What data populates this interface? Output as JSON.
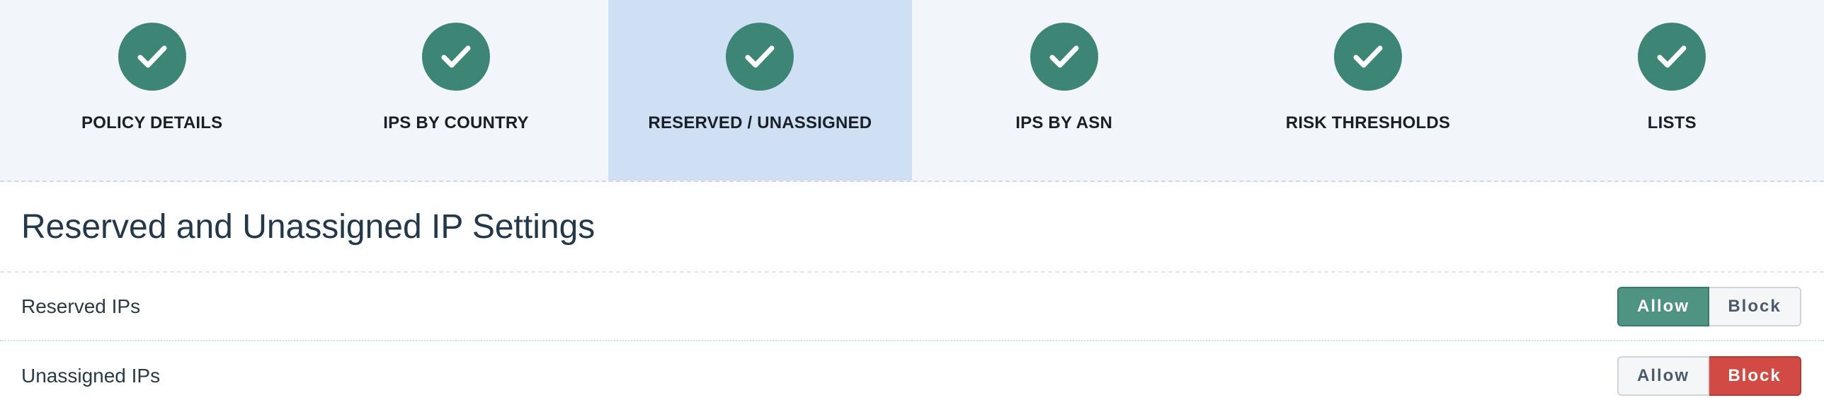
{
  "stepper": {
    "active_index": 2,
    "steps": [
      {
        "label": "POLICY DETAILS",
        "status": "complete",
        "icon": "check-icon"
      },
      {
        "label": "IPS BY COUNTRY",
        "status": "complete",
        "icon": "check-icon"
      },
      {
        "label": "RESERVED / UNASSIGNED",
        "status": "complete",
        "icon": "check-icon"
      },
      {
        "label": "IPS BY ASN",
        "status": "complete",
        "icon": "check-icon"
      },
      {
        "label": "RISK THRESHOLDS",
        "status": "complete",
        "icon": "check-icon"
      },
      {
        "label": "LISTS",
        "status": "complete",
        "icon": "check-icon"
      }
    ]
  },
  "page": {
    "title": "Reserved and Unassigned IP Settings"
  },
  "settings": [
    {
      "label": "Reserved IPs",
      "allow_label": "Allow",
      "block_label": "Block",
      "selected": "Allow"
    },
    {
      "label": "Unassigned IPs",
      "allow_label": "Allow",
      "block_label": "Block",
      "selected": "Block"
    }
  ],
  "colors": {
    "step_complete": "#3d8676",
    "step_active_bg": "#cfe0f4",
    "allow_selected": "#4f9382",
    "block_selected": "#d14b44"
  }
}
